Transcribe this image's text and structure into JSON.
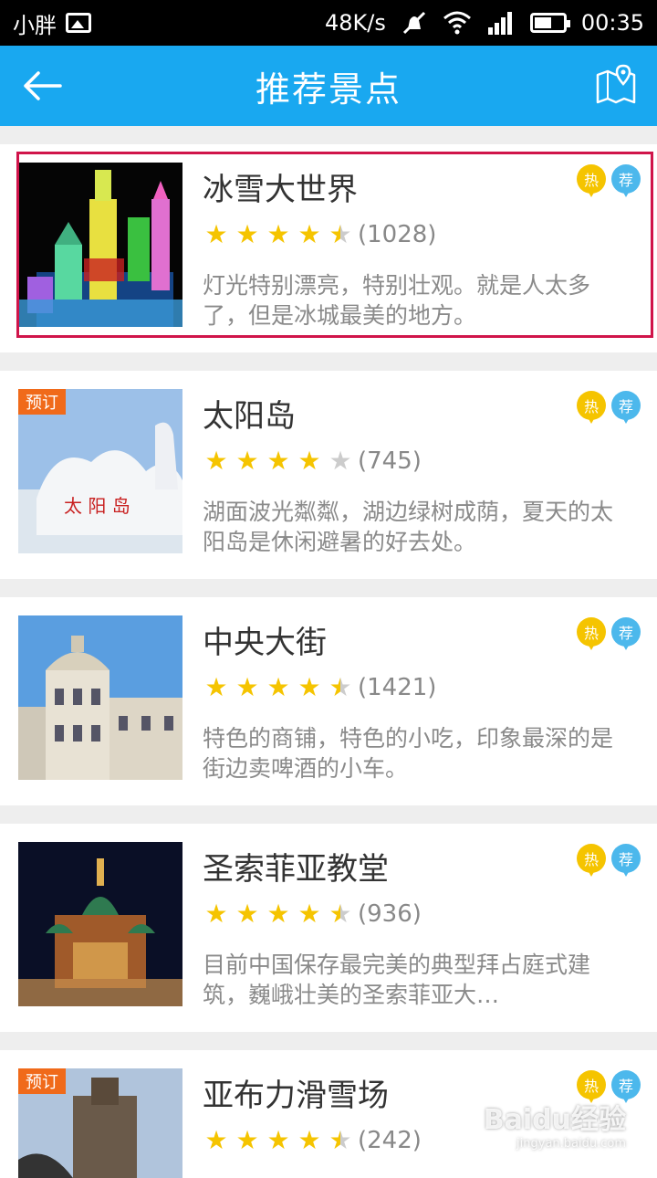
{
  "status": {
    "carrier": "小胖",
    "speed": "48K/s",
    "time": "00:35"
  },
  "header": {
    "title": "推荐景点"
  },
  "items": [
    {
      "name": "冰雪大世界",
      "count": "(1028)",
      "desc": "灯光特别漂亮，特别壮观。就是人太多了，但是冰城最美的地方。",
      "badge": "",
      "stars": 4.5
    },
    {
      "name": "太阳岛",
      "count": "(745)",
      "desc": "湖面波光粼粼，湖边绿树成荫，夏天的太阳岛是休闲避暑的好去处。",
      "badge": "预订",
      "stars": 4
    },
    {
      "name": "中央大街",
      "count": "(1421)",
      "desc": "特色的商铺，特色的小吃，印象最深的是街边卖啤酒的小车。",
      "badge": "",
      "stars": 4.5
    },
    {
      "name": "圣索菲亚教堂",
      "count": "(936)",
      "desc": "目前中国保存最完美的典型拜占庭式建筑，巍峨壮美的圣索菲亚大…",
      "badge": "",
      "stars": 4.5
    },
    {
      "name": "亚布力滑雪场",
      "count": "(242)",
      "desc": "",
      "badge": "预订",
      "stars": 4.5
    }
  ],
  "tags": {
    "hot": "热",
    "rec": "荐"
  },
  "watermark": {
    "brand": "Baidu经验",
    "url": "jingyan.baidu.com"
  }
}
